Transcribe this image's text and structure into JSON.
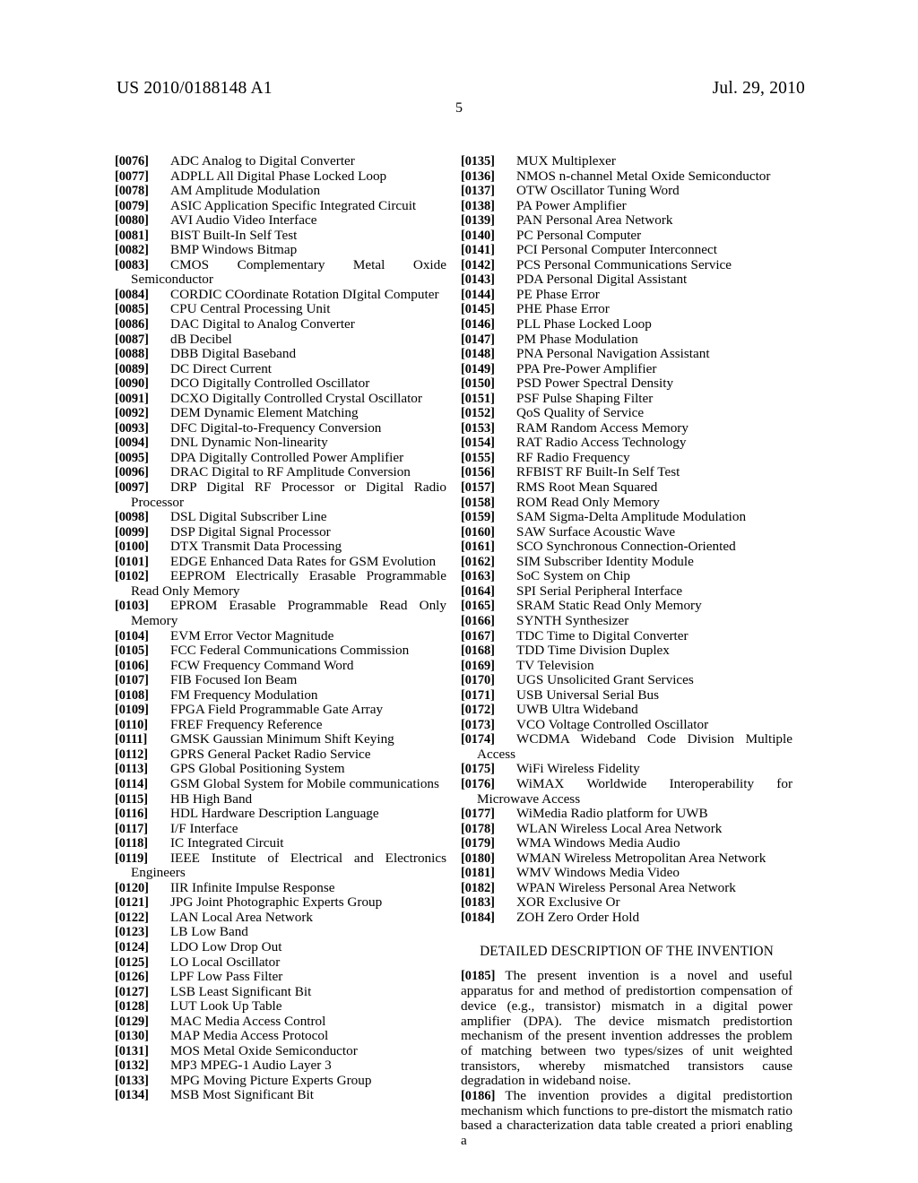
{
  "header": {
    "publication_number": "US 2010/0188148 A1",
    "publication_date": "Jul. 29, 2010",
    "page_number": "5"
  },
  "left_column": {
    "entries": [
      {
        "num": "[0076]",
        "text": "ADC Analog to Digital Converter"
      },
      {
        "num": "[0077]",
        "text": "ADPLL All Digital Phase Locked Loop"
      },
      {
        "num": "[0078]",
        "text": "AM Amplitude Modulation"
      },
      {
        "num": "[0079]",
        "text": "ASIC Application Specific Integrated Circuit"
      },
      {
        "num": "[0080]",
        "text": "AVI Audio Video Interface"
      },
      {
        "num": "[0081]",
        "text": "BIST Built-In Self Test"
      },
      {
        "num": "[0082]",
        "text": "BMP Windows Bitmap"
      },
      {
        "num": "[0083]",
        "text": "CMOS Complementary Metal Oxide Semiconductor"
      },
      {
        "num": "[0084]",
        "text": "CORDIC COordinate Rotation DIgital Computer"
      },
      {
        "num": "[0085]",
        "text": "CPU Central Processing Unit"
      },
      {
        "num": "[0086]",
        "text": "DAC Digital to Analog Converter"
      },
      {
        "num": "[0087]",
        "text": "dB Decibel"
      },
      {
        "num": "[0088]",
        "text": "DBB Digital Baseband"
      },
      {
        "num": "[0089]",
        "text": "DC Direct Current"
      },
      {
        "num": "[0090]",
        "text": "DCO Digitally Controlled Oscillator"
      },
      {
        "num": "[0091]",
        "text": "DCXO Digitally Controlled Crystal Oscillator"
      },
      {
        "num": "[0092]",
        "text": "DEM Dynamic Element Matching"
      },
      {
        "num": "[0093]",
        "text": "DFC Digital-to-Frequency Conversion"
      },
      {
        "num": "[0094]",
        "text": "DNL Dynamic Non-linearity"
      },
      {
        "num": "[0095]",
        "text": "DPA Digitally Controlled Power Amplifier"
      },
      {
        "num": "[0096]",
        "text": "DRAC Digital to RF Amplitude Conversion"
      },
      {
        "num": "[0097]",
        "text": "DRP Digital RF Processor or Digital Radio Processor"
      },
      {
        "num": "[0098]",
        "text": "DSL Digital Subscriber Line"
      },
      {
        "num": "[0099]",
        "text": "DSP Digital Signal Processor"
      },
      {
        "num": "[0100]",
        "text": "DTX Transmit Data Processing"
      },
      {
        "num": "[0101]",
        "text": "EDGE Enhanced Data Rates for GSM Evolution"
      },
      {
        "num": "[0102]",
        "text": "EEPROM Electrically Erasable Programmable Read Only Memory"
      },
      {
        "num": "[0103]",
        "text": "EPROM Erasable Programmable Read Only Memory"
      },
      {
        "num": "[0104]",
        "text": "EVM Error Vector Magnitude"
      },
      {
        "num": "[0105]",
        "text": "FCC Federal Communications Commission"
      },
      {
        "num": "[0106]",
        "text": "FCW Frequency Command Word"
      },
      {
        "num": "[0107]",
        "text": "FIB Focused Ion Beam"
      },
      {
        "num": "[0108]",
        "text": "FM Frequency Modulation"
      },
      {
        "num": "[0109]",
        "text": "FPGA Field Programmable Gate Array"
      },
      {
        "num": "[0110]",
        "text": "FREF Frequency Reference"
      },
      {
        "num": "[0111]",
        "text": "GMSK Gaussian Minimum Shift Keying"
      },
      {
        "num": "[0112]",
        "text": "GPRS General Packet Radio Service"
      },
      {
        "num": "[0113]",
        "text": "GPS Global Positioning System"
      },
      {
        "num": "[0114]",
        "text": "GSM Global System for Mobile communications"
      },
      {
        "num": "[0115]",
        "text": "HB High Band"
      },
      {
        "num": "[0116]",
        "text": "HDL Hardware Description Language"
      },
      {
        "num": "[0117]",
        "text": "I/F Interface"
      },
      {
        "num": "[0118]",
        "text": "IC Integrated Circuit"
      },
      {
        "num": "[0119]",
        "text": "IEEE Institute of Electrical and Electronics Engineers"
      },
      {
        "num": "[0120]",
        "text": "IIR Infinite Impulse Response"
      },
      {
        "num": "[0121]",
        "text": "JPG Joint Photographic Experts Group"
      },
      {
        "num": "[0122]",
        "text": "LAN Local Area Network"
      },
      {
        "num": "[0123]",
        "text": "LB Low Band"
      },
      {
        "num": "[0124]",
        "text": "LDO Low Drop Out"
      },
      {
        "num": "[0125]",
        "text": "LO Local Oscillator"
      },
      {
        "num": "[0126]",
        "text": "LPF Low Pass Filter"
      },
      {
        "num": "[0127]",
        "text": "LSB Least Significant Bit"
      },
      {
        "num": "[0128]",
        "text": "LUT Look Up Table"
      },
      {
        "num": "[0129]",
        "text": "MAC Media Access Control"
      },
      {
        "num": "[0130]",
        "text": "MAP Media Access Protocol"
      },
      {
        "num": "[0131]",
        "text": "MOS Metal Oxide Semiconductor"
      },
      {
        "num": "[0132]",
        "text": "MP3 MPEG-1 Audio Layer 3"
      },
      {
        "num": "[0133]",
        "text": "MPG Moving Picture Experts Group"
      },
      {
        "num": "[0134]",
        "text": "MSB Most Significant Bit"
      }
    ]
  },
  "right_column": {
    "entries": [
      {
        "num": "[0135]",
        "text": "MUX Multiplexer"
      },
      {
        "num": "[0136]",
        "text": "NMOS n-channel Metal Oxide Semiconductor"
      },
      {
        "num": "[0137]",
        "text": "OTW Oscillator Tuning Word"
      },
      {
        "num": "[0138]",
        "text": "PA Power Amplifier"
      },
      {
        "num": "[0139]",
        "text": "PAN Personal Area Network"
      },
      {
        "num": "[0140]",
        "text": "PC Personal Computer"
      },
      {
        "num": "[0141]",
        "text": "PCI Personal Computer Interconnect"
      },
      {
        "num": "[0142]",
        "text": "PCS Personal Communications Service"
      },
      {
        "num": "[0143]",
        "text": "PDA Personal Digital Assistant"
      },
      {
        "num": "[0144]",
        "text": "PE Phase Error"
      },
      {
        "num": "[0145]",
        "text": "PHE Phase Error"
      },
      {
        "num": "[0146]",
        "text": "PLL Phase Locked Loop"
      },
      {
        "num": "[0147]",
        "text": "PM Phase Modulation"
      },
      {
        "num": "[0148]",
        "text": "PNA Personal Navigation Assistant"
      },
      {
        "num": "[0149]",
        "text": "PPA Pre-Power Amplifier"
      },
      {
        "num": "[0150]",
        "text": "PSD Power Spectral Density"
      },
      {
        "num": "[0151]",
        "text": "PSF Pulse Shaping Filter"
      },
      {
        "num": "[0152]",
        "text": "QoS Quality of Service"
      },
      {
        "num": "[0153]",
        "text": "RAM Random Access Memory"
      },
      {
        "num": "[0154]",
        "text": "RAT Radio Access Technology"
      },
      {
        "num": "[0155]",
        "text": "RF Radio Frequency"
      },
      {
        "num": "[0156]",
        "text": "RFBIST RF Built-In Self Test"
      },
      {
        "num": "[0157]",
        "text": "RMS Root Mean Squared"
      },
      {
        "num": "[0158]",
        "text": "ROM Read Only Memory"
      },
      {
        "num": "[0159]",
        "text": "SAM Sigma-Delta Amplitude Modulation"
      },
      {
        "num": "[0160]",
        "text": "SAW Surface Acoustic Wave"
      },
      {
        "num": "[0161]",
        "text": "SCO Synchronous Connection-Oriented"
      },
      {
        "num": "[0162]",
        "text": "SIM Subscriber Identity Module"
      },
      {
        "num": "[0163]",
        "text": "SoC System on Chip"
      },
      {
        "num": "[0164]",
        "text": "SPI Serial Peripheral Interface"
      },
      {
        "num": "[0165]",
        "text": "SRAM Static Read Only Memory"
      },
      {
        "num": "[0166]",
        "text": "SYNTH Synthesizer"
      },
      {
        "num": "[0167]",
        "text": "TDC Time to Digital Converter"
      },
      {
        "num": "[0168]",
        "text": "TDD Time Division Duplex"
      },
      {
        "num": "[0169]",
        "text": "TV Television"
      },
      {
        "num": "[0170]",
        "text": "UGS Unsolicited Grant Services"
      },
      {
        "num": "[0171]",
        "text": "USB Universal Serial Bus"
      },
      {
        "num": "[0172]",
        "text": "UWB Ultra Wideband"
      },
      {
        "num": "[0173]",
        "text": "VCO Voltage Controlled Oscillator"
      },
      {
        "num": "[0174]",
        "text": "WCDMA Wideband Code Division Multiple Access"
      },
      {
        "num": "[0175]",
        "text": "WiFi Wireless Fidelity"
      },
      {
        "num": "[0176]",
        "text": "WiMAX Worldwide Interoperability for Microwave Access"
      },
      {
        "num": "[0177]",
        "text": "WiMedia Radio platform for UWB"
      },
      {
        "num": "[0178]",
        "text": "WLAN Wireless Local Area Network"
      },
      {
        "num": "[0179]",
        "text": "WMA Windows Media Audio"
      },
      {
        "num": "[0180]",
        "text": "WMAN Wireless Metropolitan Area Network"
      },
      {
        "num": "[0181]",
        "text": "WMV Windows Media Video"
      },
      {
        "num": "[0182]",
        "text": "WPAN Wireless Personal Area Network"
      },
      {
        "num": "[0183]",
        "text": "XOR Exclusive Or"
      },
      {
        "num": "[0184]",
        "text": "ZOH Zero Order Hold"
      }
    ],
    "section_heading": "DETAILED DESCRIPTION OF THE INVENTION",
    "paragraphs": [
      {
        "num": "[0185]",
        "text": "The present invention is a novel and useful apparatus for and method of predistortion compensation of device (e.g., transistor) mismatch in a digital power amplifier (DPA). The device mismatch predistortion mechanism of the present invention addresses the problem of matching between two types/sizes of unit weighted transistors, whereby mismatched transistors cause degradation in wideband noise."
      },
      {
        "num": "[0186]",
        "text": "The invention provides a digital predistortion mechanism which functions to pre-distort the mismatch ratio based a characterization data table created a priori enabling a"
      }
    ]
  }
}
